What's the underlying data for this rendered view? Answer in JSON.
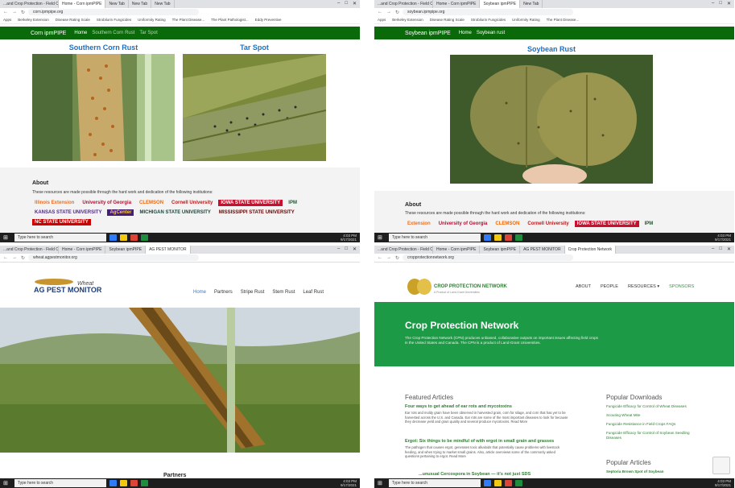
{
  "corn": {
    "tabs": [
      "...and Crop Protection - Field Crops",
      "Home - Corn ipmPIPE",
      "New Tab",
      "New Tab",
      "New Tab",
      "New Tab"
    ],
    "url": "corn.ipmpipe.org",
    "bookmarks": [
      "Apps",
      "Berkeley Extension",
      "Disease Rating Scale",
      "Strobilurin Fungicides",
      "Uniformity Rating",
      "The Plant Disease...",
      "The Plant Pathologist...",
      "Eddy Preventive"
    ],
    "site": "Corn ipmPIPE",
    "nav": [
      "Home",
      "Southern Corn Rust",
      "Tar Spot"
    ],
    "headings": [
      "Southern Corn Rust",
      "Tar Spot"
    ],
    "about_title": "About",
    "about_text": "These resources are made possible through the hard work and dedication of the following institutions:",
    "logos": [
      "Illinois Extension",
      "University of Georgia",
      "CLEMSON",
      "Cornell University",
      "IOWA STATE UNIVERSITY",
      "IPM",
      "KANSAS STATE UNIVERSITY",
      "AgCenter",
      "MICHIGAN STATE UNIVERSITY",
      "MISSISSIPPI STATE UNIVERSITY",
      "NC STATE UNIVERSITY"
    ]
  },
  "soybean": {
    "url": "soybean.ipmpipe.org",
    "site": "Soybean ipmPIPE",
    "nav": [
      "Home",
      "Soybean rust"
    ],
    "heading": "Soybean Rust",
    "about_title": "About",
    "about_text": "These resources are made possible through the hard work and dedication of the following institutions:",
    "logos": [
      "Extension",
      "University of Georgia",
      "CLEMSON",
      "Cornell University",
      "IOWA STATE UNIVERSITY",
      "IPM"
    ]
  },
  "wheat": {
    "url": "wheat.agpestmonitor.org",
    "logo": "AG PEST MONITOR",
    "logo_sub": "Wheat",
    "nav": [
      "Home",
      "Partners",
      "Stripe Rust",
      "Stem Rust",
      "Leaf Rust"
    ],
    "partners": "Partners"
  },
  "cpn": {
    "url": "cropprotectionnetwork.org",
    "logo": "CROP PROTECTION NETWORK",
    "logo_sub": "A Product of Land-Grant Universities",
    "nav": [
      "ABOUT",
      "PEOPLE",
      "RESOURCES ▾",
      "SPONSORS"
    ],
    "hero_title": "Crop Protection Network",
    "hero_text": "The Crop Protection Network (CPN) produces unbiased, collaborative outputs on important issues affecting field crops in the United States and Canada. The CPN is a product of Land-Grant Universities.",
    "featured_title": "Featured Articles",
    "articles": [
      {
        "title": "Four ways to get ahead of ear rots and mycotoxins",
        "body": "Ear rots and moldy grain have been observed in harvested grain, corn for silage, and corn that has yet to be harvested across the U.S. and Canada. Ear rots are some of the most important diseases to look for because they decrease yield and grain quality and several produce mycotoxins. Read More"
      },
      {
        "title": "Ergot: Six things to be mindful of with ergot in small grain and grasses",
        "body": "The pathogen that causes ergot, generates toxic alkaloids that potentially cause problems with livestock feeding, and when trying to market small grains. Also, article overviews some of the commonly asked questions pertaining to ergot. Read More"
      },
      {
        "title": "...unusual Cercospora in Soybean — it's not just SDS",
        "body": ""
      }
    ],
    "downloads_title": "Popular Downloads",
    "downloads": [
      "Fungicide Efficacy for Control of Wheat Diseases",
      "Scouting Wheat Mite",
      "Fungicide Resistance in Field Crops FAQs",
      "Fungicide Efficacy for Control of Soybean Seedling Diseases"
    ],
    "popular_title": "Popular Articles",
    "popular": [
      "Septoria Brown Spot of Soybean"
    ]
  },
  "taskbar": {
    "search_placeholder": "Type here to search",
    "time": "4:03 PM",
    "date": "9/17/2021"
  }
}
